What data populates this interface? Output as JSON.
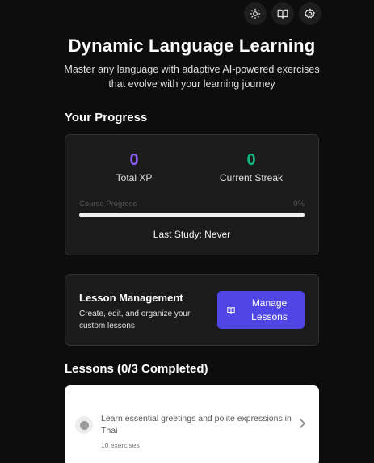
{
  "toolbar": {
    "icons": [
      "sun-icon",
      "book-icon",
      "gear-icon"
    ]
  },
  "header": {
    "title": "Dynamic Language Learning",
    "subtitle": "Master any language with adaptive AI-powered exercises that evolve with your learning journey"
  },
  "progress": {
    "section_title": "Your Progress",
    "total_xp_value": "0",
    "total_xp_label": "Total XP",
    "streak_value": "0",
    "streak_label": "Current Streak",
    "course_progress_label": "Course Progress",
    "course_progress_percent": "0%",
    "course_progress_fraction": 0,
    "last_study": "Last Study: Never",
    "colors": {
      "xp": "#8b5cf6",
      "streak": "#10b981"
    }
  },
  "lesson_management": {
    "title": "Lesson Management",
    "description": "Create, edit, and organize your custom lessons",
    "button_label": "Manage Lessons",
    "button_color": "#4f46e5"
  },
  "lessons": {
    "section_title": "Lessons (0/3 Completed)",
    "items": [
      {
        "description": "Learn essential greetings and polite expressions in Thai",
        "exercises": "10 exercises"
      }
    ]
  }
}
